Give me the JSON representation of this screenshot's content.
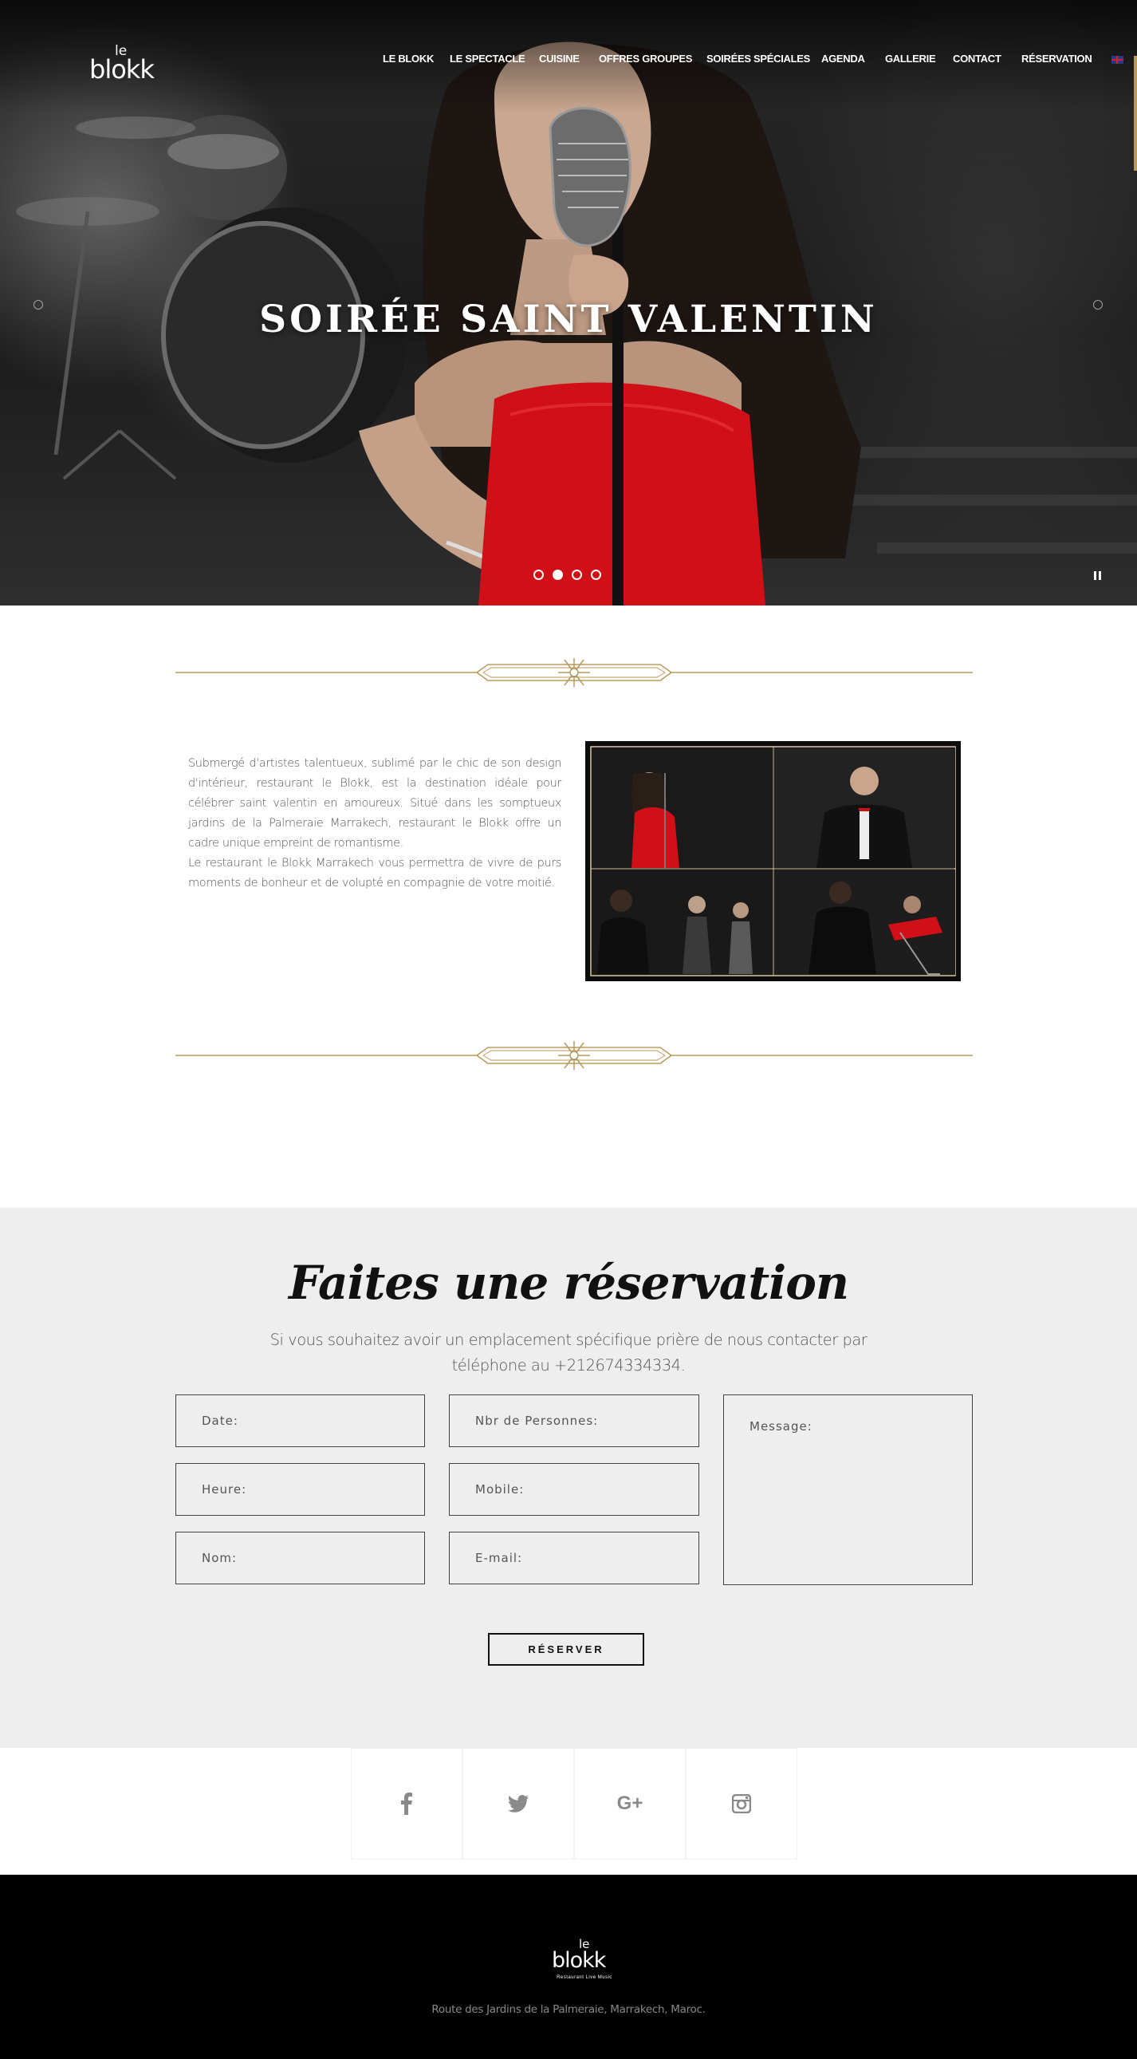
{
  "brand": {
    "logo_le": "le",
    "logo_word": "blokk",
    "logo_tagline": "Restaurant Live Music"
  },
  "nav": {
    "items": [
      {
        "label": "LE BLOKK"
      },
      {
        "label": "LE SPECTACLE"
      },
      {
        "label": "CUISINE"
      },
      {
        "label": "OFFRES GROUPES"
      },
      {
        "label": "SOIRÉES SPÉCIALES"
      },
      {
        "label": "AGENDA"
      },
      {
        "label": "GALLERIE"
      },
      {
        "label": "CONTACT"
      },
      {
        "label": "RÉSERVATION"
      }
    ],
    "language_flag": "uk-flag-icon"
  },
  "hero": {
    "title": "SOIRÉE SAINT VALENTIN",
    "slides_total": 4,
    "active_slide": 2
  },
  "content": {
    "paragraph1": "Submergé d'artistes talentueux, sublimé par le chic de son design d'intérieur, restaurant le Blokk, est la destination idéale pour célébrer saint valentin en amoureux. Situé dans les somptueux jardins de la Palmeraie Marrakech, restaurant le Blokk offre un cadre unique empreint de romantisme.",
    "paragraph2": "Le restaurant le Blokk Marrakech vous permettra de vivre de purs moments de bonheur et de volupté en compagnie de votre moitié."
  },
  "reservation": {
    "title": "Faites une réservation",
    "subtitle": "Si vous souhaitez avoir un emplacement spécifique prière de nous contacter par téléphone au +212674334334.",
    "fields": {
      "date": "Date:",
      "persons": "Nbr de Personnes:",
      "hour": "Heure:",
      "mobile": "Mobile:",
      "name": "Nom:",
      "email": "E-mail:",
      "message": "Message:"
    },
    "submit_label": "RÉSERVER"
  },
  "social": [
    "facebook-icon",
    "twitter-icon",
    "google-plus-icon",
    "instagram-icon"
  ],
  "footer": {
    "address": "Route des Jardins de la Palmeraie, Marrakech, Maroc."
  },
  "colors": {
    "accent_gold": "#b89a5d",
    "hero_red": "#d10f17",
    "reservation_bg": "#eeeeee",
    "footer_bg": "#000000"
  }
}
